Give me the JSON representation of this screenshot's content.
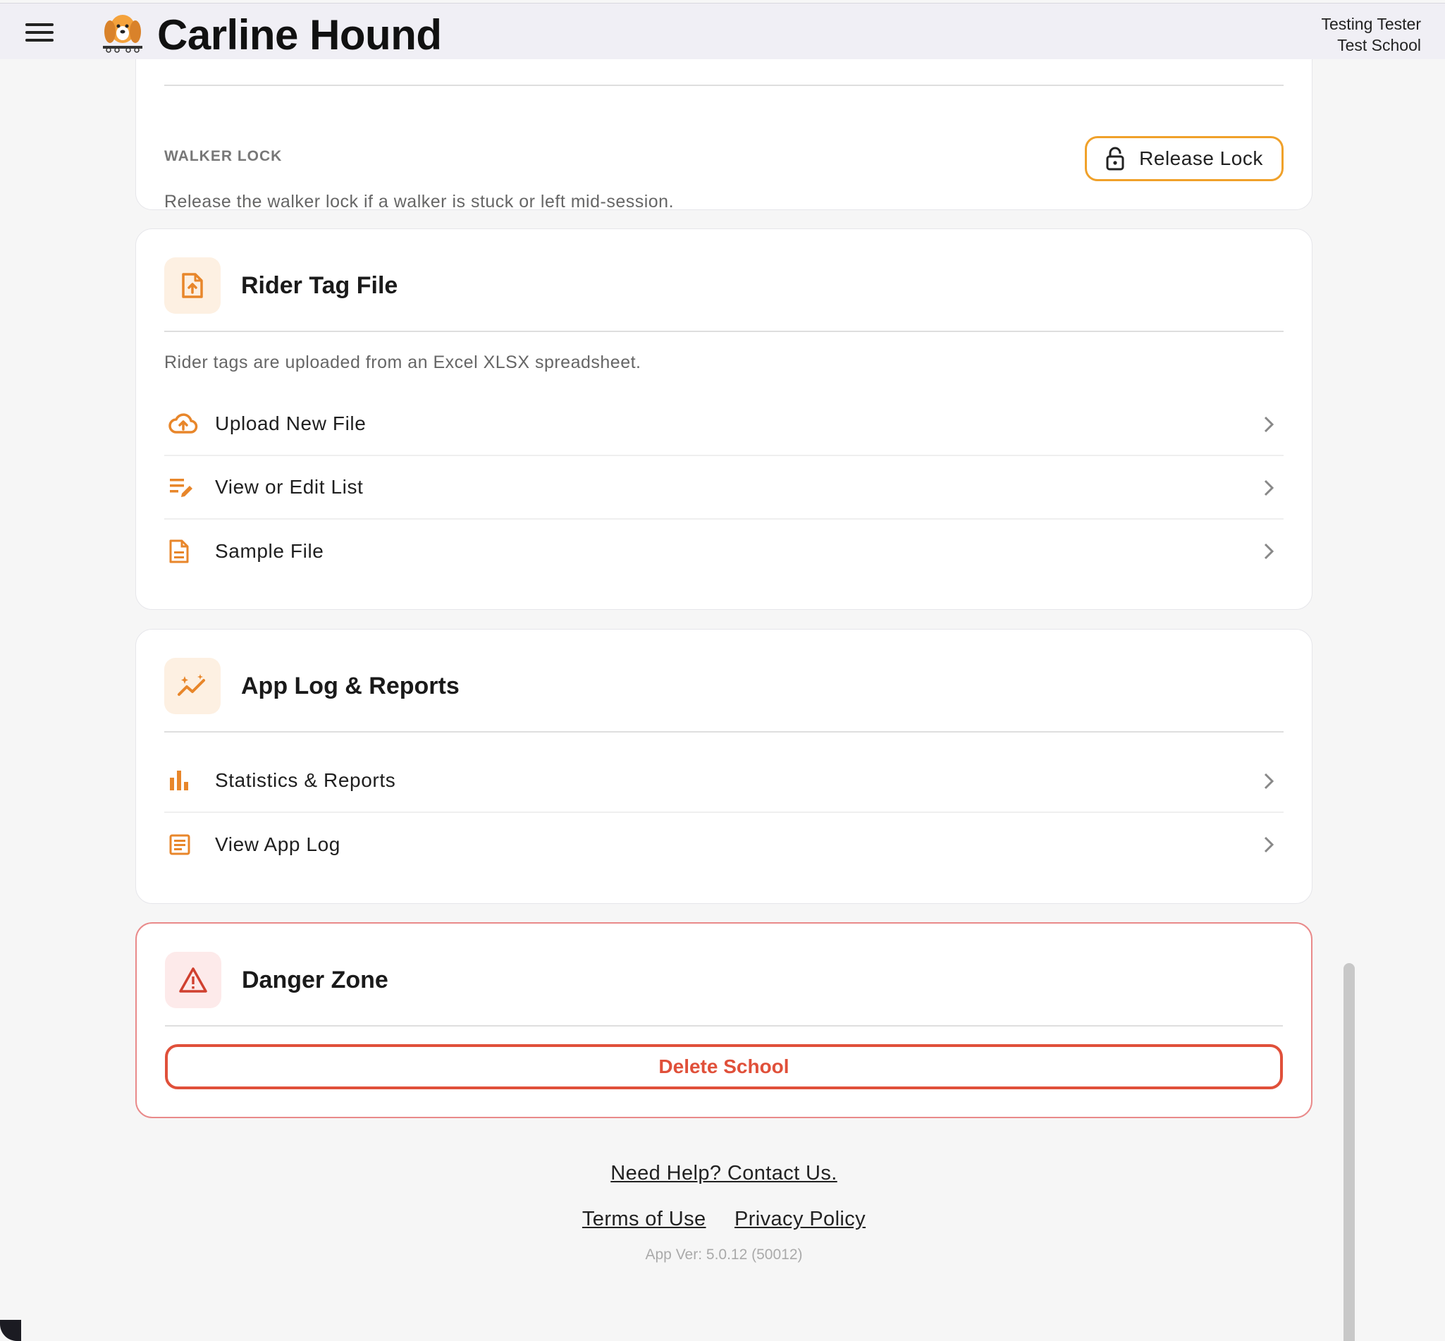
{
  "header": {
    "menu_icon": "hamburger-menu-icon",
    "logo_icon": "hound-dog-logo",
    "title": "Carline Hound",
    "user_name": "Testing Tester",
    "school_name": "Test School"
  },
  "walker_lock": {
    "label": "WALKER LOCK",
    "description": "Release the walker lock if a walker is stuck or left mid-session.",
    "button_label": "Release Lock",
    "button_icon": "lock-icon"
  },
  "rider_tag": {
    "title": "Rider Tag File",
    "icon": "file-upload-icon",
    "description": "Rider tags are uploaded from an Excel XLSX spreadsheet.",
    "items": [
      {
        "label": "Upload New File",
        "icon": "cloud-upload-icon"
      },
      {
        "label": "View or Edit List",
        "icon": "edit-list-icon"
      },
      {
        "label": "Sample File",
        "icon": "document-icon"
      }
    ]
  },
  "app_log": {
    "title": "App Log & Reports",
    "icon": "insights-icon",
    "items": [
      {
        "label": "Statistics & Reports",
        "icon": "bar-chart-icon"
      },
      {
        "label": "View App Log",
        "icon": "article-icon"
      }
    ]
  },
  "danger_zone": {
    "title": "Danger Zone",
    "icon": "warning-icon",
    "button_label": "Delete School"
  },
  "footer": {
    "help_link": "Need Help? Contact Us.",
    "terms_link": "Terms of Use",
    "privacy_link": "Privacy Policy",
    "version": "App Ver: 5.0.12 (50012)"
  },
  "colors": {
    "accent": "#f0a12a",
    "icon_orange": "#e8862a",
    "danger": "#e0503a",
    "header_bg": "#f0eff5"
  }
}
